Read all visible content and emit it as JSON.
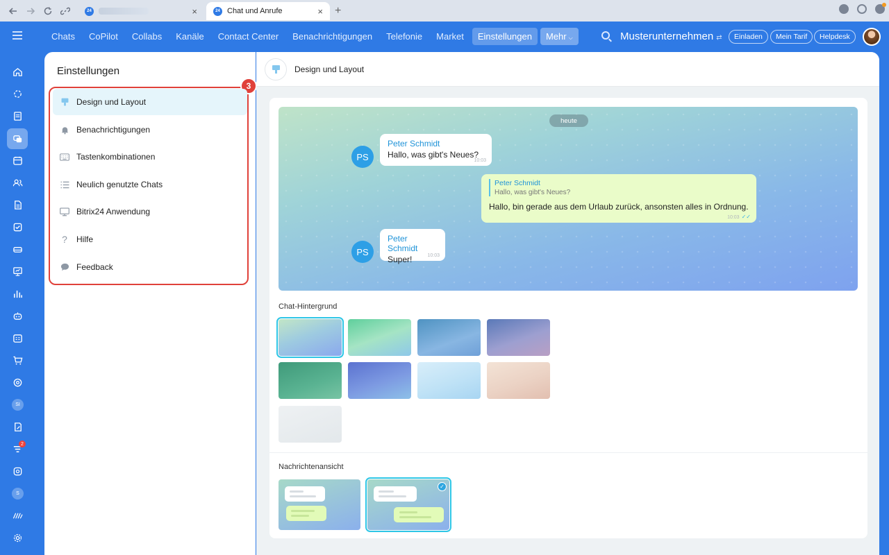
{
  "browser": {
    "tabs": [
      {
        "label": ""
      },
      {
        "label": "Chat und Anrufe"
      }
    ],
    "favicon_text": "24",
    "new_tab": "+",
    "close": "×"
  },
  "topnav": {
    "items": [
      "Chats",
      "CoPilot",
      "Collabs",
      "Kanäle",
      "Contact Center",
      "Benachrichtigungen",
      "Telefonie",
      "Market",
      "Einstellungen"
    ],
    "more_label": "Mehr",
    "company": "Musterunternehmen",
    "invite": "Einladen",
    "plan": "Mein Tarif",
    "helpdesk": "Helpdesk"
  },
  "rail": {
    "letters": [
      "SI",
      "S"
    ],
    "badge": "2"
  },
  "settings": {
    "title": "Einstellungen",
    "badge": "3",
    "items": [
      {
        "label": "Design und Layout",
        "icon": "brush-icon"
      },
      {
        "label": "Benachrichtigungen",
        "icon": "bell-icon"
      },
      {
        "label": "Tastenkombinationen",
        "icon": "keyboard-icon"
      },
      {
        "label": "Neulich genutzte Chats",
        "icon": "list-icon"
      },
      {
        "label": "Bitrix24 Anwendung",
        "icon": "monitor-icon"
      },
      {
        "label": "Hilfe",
        "icon": "question-icon"
      },
      {
        "label": "Feedback",
        "icon": "speech-bubble-icon"
      }
    ]
  },
  "main": {
    "title": "Design und Layout",
    "preview": {
      "date": "heute",
      "avatar": "PS",
      "messages": [
        {
          "sender": "Peter Schmidt",
          "text": "Hallo, was gibt's Neues?",
          "time": "10:03"
        },
        {
          "quote_name": "Peter Schmidt",
          "quote_text": "Hallo, was gibt's Neues?",
          "text": "Hallo, bin gerade aus dem Urlaub zurück, ansonsten alles in Ordnung.",
          "time": "10:03"
        },
        {
          "sender": "Peter Schmidt",
          "text": "Super!",
          "time": "10:03"
        }
      ]
    },
    "background_label": "Chat-Hintergrund",
    "view_label": "Nachrichtenansicht"
  },
  "colors": {
    "accent": "#2f7ae5",
    "highlight": "#e0413a",
    "selection": "#2ec6e6"
  }
}
